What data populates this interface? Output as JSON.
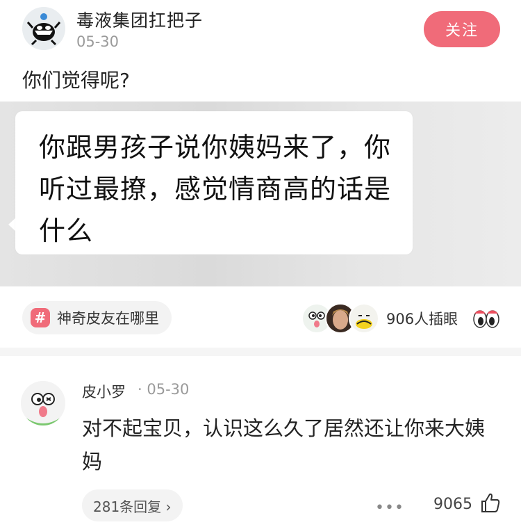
{
  "post": {
    "author": "毒液集团扛把子",
    "date": "05-30",
    "follow_label": "关注",
    "text": "你们觉得呢?",
    "image_text": "你跟男孩子说你姨妈来了，你听过最撩，感觉情商高的话是什么"
  },
  "topic": {
    "label": "神奇皮友在哪里"
  },
  "engagement": {
    "peek_count": "906人插眼"
  },
  "comment": {
    "author": "皮小罗",
    "meta": "· 05-30",
    "text": "对不起宝贝，认识这么久了居然还让你来大姨妈",
    "replies_label": "281条回复 ›",
    "more": "•••",
    "likes": "9065"
  },
  "icons": {
    "author_avatar": "venom-cartoon-avatar",
    "topic": "hash-icon",
    "peek": "eyes-icon",
    "like": "thumbs-up-icon"
  },
  "colors": {
    "accent": "#f06b79"
  }
}
